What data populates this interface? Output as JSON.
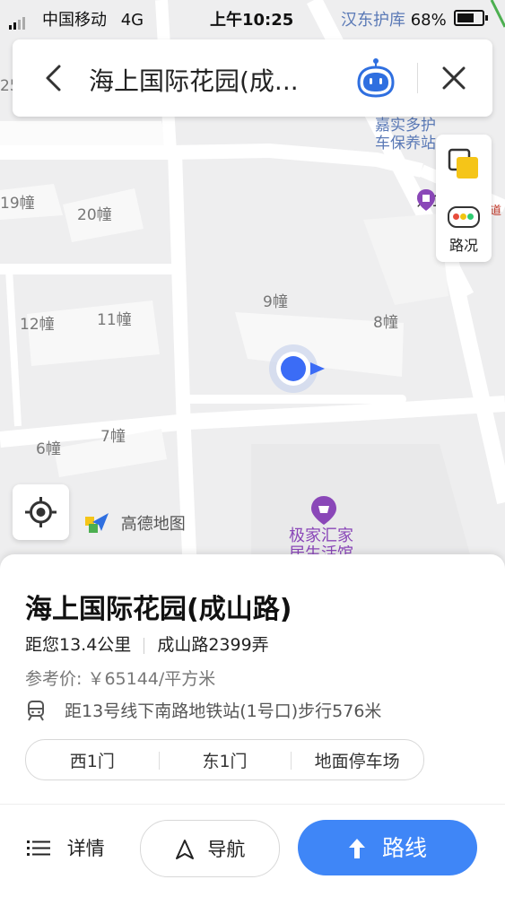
{
  "status_bar": {
    "carrier": "中国移动",
    "network": "4G",
    "time": "上午10:25",
    "overlay_text": "汉东护库",
    "battery": "68%"
  },
  "search_bar": {
    "title": "海上国际花园(成..."
  },
  "map": {
    "building_labels": [
      "19幢",
      "20幢",
      "9幢",
      "8幢",
      "12幢",
      "11幢",
      "7幢",
      "6幢",
      "25"
    ],
    "poi_top_right": [
      "嘉实多护",
      "车保养站"
    ],
    "poi_gate": "东1门",
    "poi_bottom": [
      "极家汇家",
      "居生活馆"
    ],
    "road_marker": "道",
    "brand": "高德地图"
  },
  "side_controls": {
    "traffic_label": "路况"
  },
  "place": {
    "name": "海上国际花园(成山路)",
    "distance": "距您13.4公里",
    "address": "成山路2399弄",
    "price": "参考价: ￥65144/平方米",
    "metro": "距13号线下南路地铁站(1号口)步行576米",
    "gates": [
      "西1门",
      "东1门",
      "地面停车场"
    ]
  },
  "actions": {
    "detail_label": "详情",
    "nav_label": "导航",
    "route_label": "路线"
  },
  "colors": {
    "accent": "#3f86f7",
    "location_dot": "#3b6cf6",
    "poi_purple": "#8a47b8"
  }
}
